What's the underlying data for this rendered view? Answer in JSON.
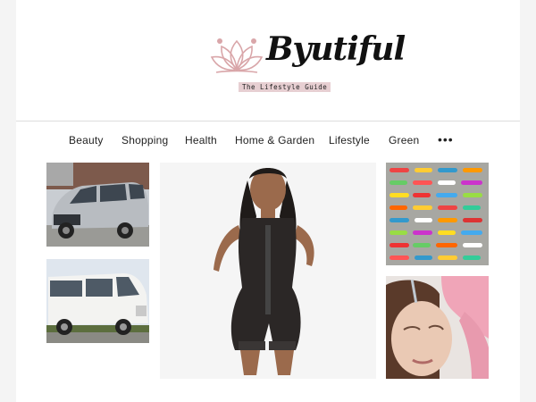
{
  "brand": {
    "name": "Byutiful",
    "tagline": "The Lifestyle Guide"
  },
  "nav": {
    "items": [
      "Beauty",
      "Shopping",
      "Health",
      "Home & Garden",
      "Lifestyle",
      "Green"
    ],
    "more_label": "•••"
  },
  "colors": {
    "accent_pink": "#e7cfd2",
    "lotus": "#d9a6a9"
  },
  "tiles": [
    {
      "name": "silver-minivan-photo",
      "icon": "minivan-image"
    },
    {
      "name": "white-van-photo",
      "icon": "van-image"
    },
    {
      "name": "bodysuit-model-photo",
      "icon": "shapewear-image"
    },
    {
      "name": "fishing-lures-photo",
      "icon": "lures-image"
    },
    {
      "name": "facial-treatment-photo",
      "icon": "beauty-image"
    }
  ]
}
